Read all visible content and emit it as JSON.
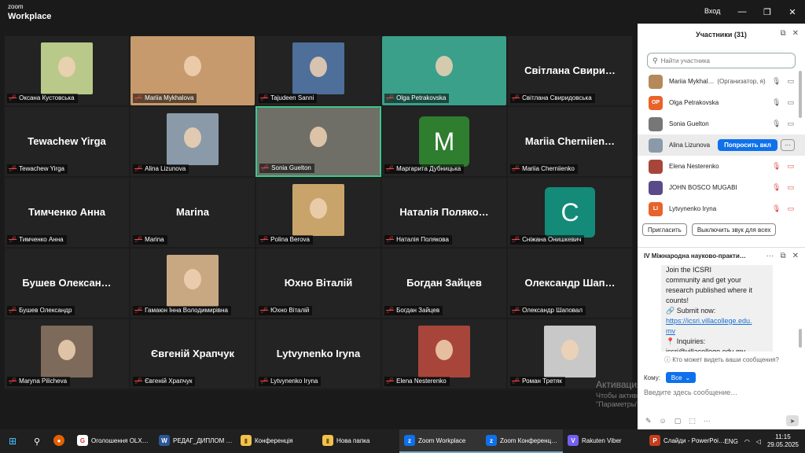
{
  "window": {
    "logo_top": "zoom",
    "logo_bottom": "Workplace",
    "signin": "Вход",
    "min": "—",
    "max": "❐",
    "close": "✕"
  },
  "grid": {
    "tiles": [
      {
        "tag": "Оксана Кустовська",
        "big": "",
        "photo": "#b9c98a"
      },
      {
        "tag": "Mariia Mykhalova",
        "big": "",
        "photo": "#c69a6c"
      },
      {
        "tag": "Tajudeen Sanni",
        "big": "",
        "photo": "#4d6f9a"
      },
      {
        "tag": "Olga Petrakovska",
        "big": "",
        "photo": "#3aa08a"
      },
      {
        "tag": "Світлана Свиридовська",
        "big": "Світлана Свири…",
        "photo": ""
      },
      {
        "tag": "Tewachew Yirga",
        "big": "Tewachew Yirga",
        "photo": ""
      },
      {
        "tag": "Alina Lizunova",
        "big": "",
        "photo": "#8a9aa8"
      },
      {
        "tag": "Sonia Guelton",
        "big": "",
        "photo": "#6f6f68"
      },
      {
        "tag": "Маргарита Дубницька",
        "big": "",
        "photo": "",
        "letter": "M",
        "letter_color": "#2f7d2f"
      },
      {
        "tag": "Mariia Cherniienko",
        "big": "Mariia Cherniien…",
        "photo": ""
      },
      {
        "tag": "Тимченко Анна",
        "big": "Тимченко Анна",
        "photo": ""
      },
      {
        "tag": "Marina",
        "big": "Marina",
        "photo": ""
      },
      {
        "tag": "Polina Berova",
        "big": "",
        "photo": "#c9a46a"
      },
      {
        "tag": "Наталія Полякова",
        "big": "Наталія Поляко…",
        "photo": ""
      },
      {
        "tag": "Сніжана Онишкевич",
        "big": "",
        "photo": "",
        "letter": "C",
        "letter_color": "#138b78"
      },
      {
        "tag": "Бушев Олександр",
        "big": "Бушев Олексан…",
        "photo": ""
      },
      {
        "tag": "Гамаюн Інна Володимирівна",
        "big": "",
        "photo": "#c8a882"
      },
      {
        "tag": "Юхно Віталій",
        "big": "Юхно Віталій",
        "photo": ""
      },
      {
        "tag": "Богдан Зайцев",
        "big": "Богдан Зайцев",
        "photo": ""
      },
      {
        "tag": "Олександр Шаповал",
        "big": "Олександр Шап…",
        "photo": ""
      },
      {
        "tag": "Maryna Pilicheva",
        "big": "",
        "photo": "#7d6a5a"
      },
      {
        "tag": "Євгеній Храпчук",
        "big": "Євгеній Храпчук",
        "photo": ""
      },
      {
        "tag": "Lytvynenko Iryna",
        "big": "Lytvynenko Iryna",
        "photo": ""
      },
      {
        "tag": "Elena Nesterenko",
        "big": "",
        "photo": "#a8453a"
      },
      {
        "tag": "Роман Третяк",
        "big": "",
        "photo": "#c8c8c8"
      }
    ]
  },
  "watermark": {
    "title": "Активация Windows",
    "body": "Чтобы активировать Windows, перейдите в раздел \"Параметры\"."
  },
  "participants": {
    "title": "Участники (31)",
    "search_placeholder": "Найти участника",
    "list": [
      {
        "name": "Mariia Mykhal…",
        "role": "(Организатор, я)",
        "initials": "",
        "color": "#b48a5a"
      },
      {
        "name": "Olga Petrakovska",
        "role": "",
        "initials": "OP",
        "color": "#e8632b"
      },
      {
        "name": "Sonia Guelton",
        "role": "",
        "initials": "",
        "color": "#777"
      },
      {
        "name": "Alina Lizunova",
        "role": "",
        "initials": "",
        "color": "#8a9aa8"
      },
      {
        "name": "Elena Nesterenko",
        "role": "",
        "initials": "",
        "color": "#a8453a"
      },
      {
        "name": "JOHN BOSCO MUGABI",
        "role": "",
        "initials": "",
        "color": "#5a4a8a"
      },
      {
        "name": "Lytvynenko Iryna",
        "role": "",
        "initials": "LI",
        "color": "#e8632b"
      }
    ],
    "ask_unmute": "Попросить вкл",
    "more": "···",
    "invite": "Пригласить",
    "mute_all": "Выключить звук для всех"
  },
  "chat": {
    "title": "IV Міжнародна науково-практи…",
    "lines": [
      "Join the ICSRI",
      "community and get your",
      "research published where it",
      "counts!",
      "🔗 Submit now:",
      "https://icsri.villacollege.edu.",
      "mv",
      "📍 Inquiries:",
      "icsri@villacollege.edu.my"
    ],
    "who_can_see": "Кто может видеть ваши сообщения?",
    "to_label": "Кому:",
    "to_value": "Все",
    "input_placeholder": "Введите здесь сообщение…"
  },
  "taskbar": {
    "apps": [
      {
        "label": "Оголошення OLX…",
        "icon": "G",
        "color": "#fff",
        "fg": "#d33"
      },
      {
        "label": "РЕДАГ_ДИПЛОМ …",
        "icon": "W",
        "color": "#2b5797",
        "fg": "#fff"
      },
      {
        "label": "Конференція",
        "icon": "▮",
        "color": "#f2c14e",
        "fg": "#7a5a00"
      },
      {
        "label": "Нова папка",
        "icon": "▮",
        "color": "#f2c14e",
        "fg": "#7a5a00"
      },
      {
        "label": "Zoom Workplace",
        "icon": "z",
        "color": "#0e71eb",
        "fg": "#fff"
      },
      {
        "label": "Zoom Конференц…",
        "icon": "z",
        "color": "#0e71eb",
        "fg": "#fff"
      },
      {
        "label": "Rakuten Viber",
        "icon": "V",
        "color": "#7360f2",
        "fg": "#fff"
      },
      {
        "label": "Слайди - PowerPoi…",
        "icon": "P",
        "color": "#c43e1c",
        "fg": "#fff"
      }
    ],
    "lang": "ENG",
    "time": "11:15",
    "date": "29.05.2025"
  }
}
